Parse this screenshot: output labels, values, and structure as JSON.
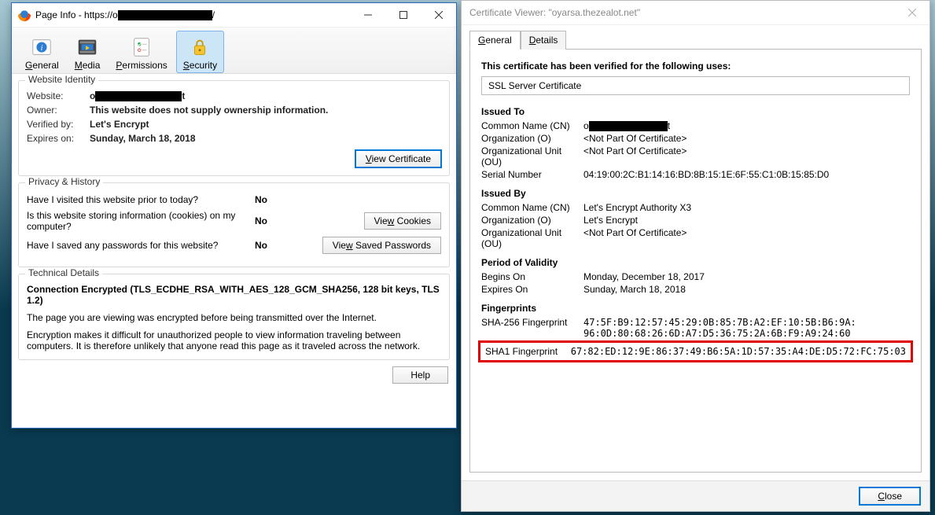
{
  "left_window": {
    "title_prefix": "Page Info - https://o",
    "title_suffix": "/",
    "toolbar": {
      "general": "General",
      "media": "Media",
      "permissions": "Permissions",
      "security": "Security"
    },
    "identity": {
      "group_title": "Website Identity",
      "website_label": "Website:",
      "website_prefix": "o",
      "website_suffix": "t",
      "owner_label": "Owner:",
      "owner_value": "This website does not supply ownership information.",
      "verified_label": "Verified by:",
      "verified_value": "Let's Encrypt",
      "expires_label": "Expires on:",
      "expires_value": "Sunday, March 18, 2018",
      "view_cert_btn": "View Certificate"
    },
    "privacy": {
      "group_title": "Privacy & History",
      "q1": "Have I visited this website prior to today?",
      "a1": "No",
      "q2": "Is this website storing information (cookies) on my computer?",
      "a2": "No",
      "btn_cookies": "View Cookies",
      "q3": "Have I saved any passwords for this website?",
      "a3": "No",
      "btn_passwords": "View Saved Passwords"
    },
    "technical": {
      "group_title": "Technical Details",
      "headline": "Connection Encrypted (TLS_ECDHE_RSA_WITH_AES_128_GCM_SHA256, 128 bit keys, TLS 1.2)",
      "line1": "The page you are viewing was encrypted before being transmitted over the Internet.",
      "line2": "Encryption makes it difficult for unauthorized people to view information traveling between computers. It is therefore unlikely that anyone read this page as it traveled across the network."
    },
    "help_btn": "Help"
  },
  "right_window": {
    "title": "Certificate Viewer: \"oyarsa.thezealot.net\"",
    "tabs": {
      "general": "General",
      "details": "Details"
    },
    "verified_text": "This certificate has been verified for the following uses:",
    "use": "SSL Server Certificate",
    "issued_to": {
      "title": "Issued To",
      "cn_label": "Common Name (CN)",
      "cn_prefix": "o",
      "cn_suffix": "t",
      "o_label": "Organization (O)",
      "o_value": "<Not Part Of Certificate>",
      "ou_label": "Organizational Unit (OU)",
      "ou_value": "<Not Part Of Certificate>",
      "serial_label": "Serial Number",
      "serial_value": "04:19:00:2C:B1:14:16:BD:8B:15:1E:6F:55:C1:0B:15:85:D0"
    },
    "issued_by": {
      "title": "Issued By",
      "cn_label": "Common Name (CN)",
      "cn_value": "Let's Encrypt Authority X3",
      "o_label": "Organization (O)",
      "o_value": "Let's Encrypt",
      "ou_label": "Organizational Unit (OU)",
      "ou_value": "<Not Part Of Certificate>"
    },
    "validity": {
      "title": "Period of Validity",
      "begins_label": "Begins On",
      "begins_value": "Monday, December 18, 2017",
      "expires_label": "Expires On",
      "expires_value": "Sunday, March 18, 2018"
    },
    "fingerprints": {
      "title": "Fingerprints",
      "sha256_label": "SHA-256 Fingerprint",
      "sha256_line1": "47:5F:B9:12:57:45:29:0B:85:7B:A2:EF:10:5B:B6:9A:",
      "sha256_line2": "96:0D:80:68:26:6D:A7:D5:36:75:2A:6B:F9:A9:24:60",
      "sha1_label": "SHA1 Fingerprint",
      "sha1_value": "67:82:ED:12:9E:86:37:49:B6:5A:1D:57:35:A4:DE:D5:72:FC:75:03"
    },
    "close_btn": "Close"
  }
}
